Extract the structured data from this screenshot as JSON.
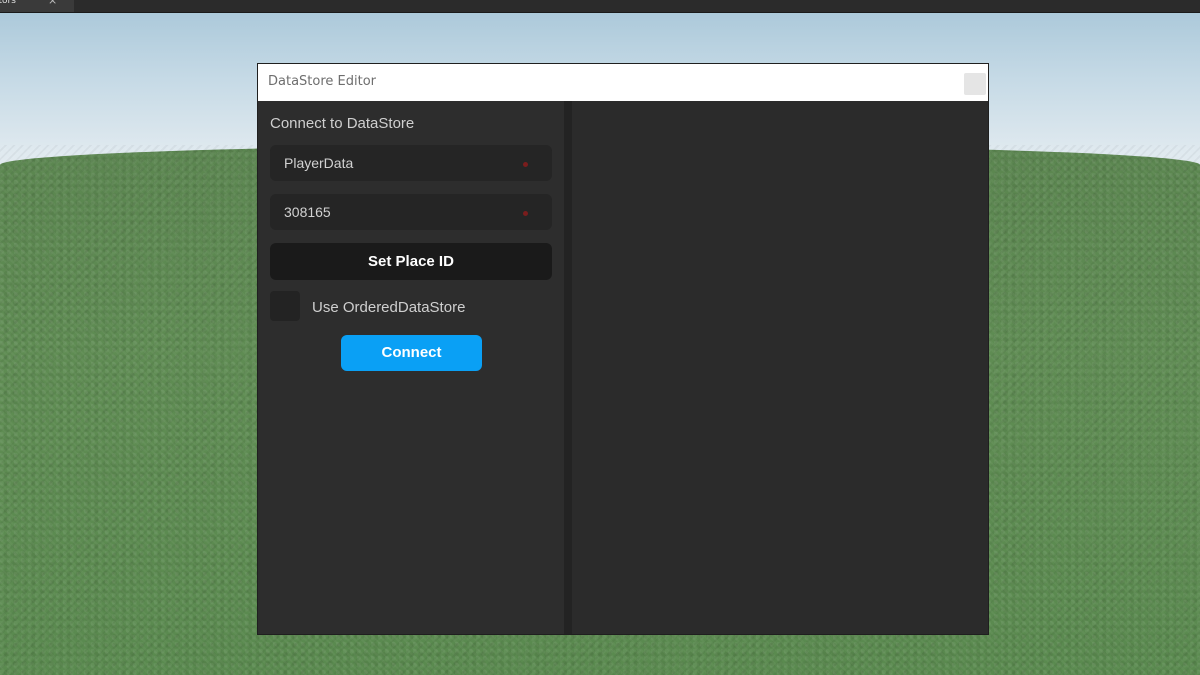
{
  "topbar": {
    "tab_label": "itors",
    "tab_close": "×"
  },
  "window": {
    "title": "DataStore Editor"
  },
  "connect_panel": {
    "heading": "Connect to DataStore",
    "datastore_name_value": "PlayerData",
    "place_id_value": "308165",
    "set_place_id_label": "Set Place ID",
    "ordered_checkbox_label": "Use OrderedDataStore",
    "ordered_checked": false,
    "connect_label": "Connect"
  },
  "colors": {
    "connect_accent": "#0aa0f5",
    "panel_bg": "#2d2d2d",
    "field_bg": "#252525",
    "error_dot": "#7a1d1d"
  }
}
